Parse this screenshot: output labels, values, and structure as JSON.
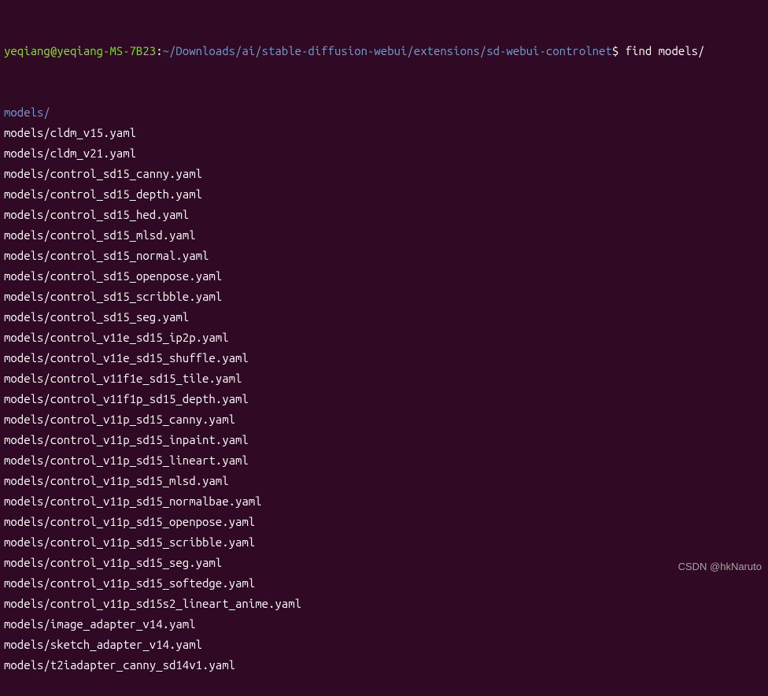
{
  "prompt": {
    "user_host": "yeqiang@yeqiang-MS-7B23",
    "separator1": ":",
    "path": "~/Downloads/ai/stable-diffusion-webui/extensions/sd-webui-controlnet",
    "separator2": "$ ",
    "command": "find models/"
  },
  "output": [
    {
      "text": "models/",
      "is_dir": true
    },
    {
      "text": "models/cldm_v15.yaml",
      "is_dir": false
    },
    {
      "text": "models/cldm_v21.yaml",
      "is_dir": false
    },
    {
      "text": "models/control_sd15_canny.yaml",
      "is_dir": false
    },
    {
      "text": "models/control_sd15_depth.yaml",
      "is_dir": false
    },
    {
      "text": "models/control_sd15_hed.yaml",
      "is_dir": false
    },
    {
      "text": "models/control_sd15_mlsd.yaml",
      "is_dir": false
    },
    {
      "text": "models/control_sd15_normal.yaml",
      "is_dir": false
    },
    {
      "text": "models/control_sd15_openpose.yaml",
      "is_dir": false
    },
    {
      "text": "models/control_sd15_scribble.yaml",
      "is_dir": false
    },
    {
      "text": "models/control_sd15_seg.yaml",
      "is_dir": false
    },
    {
      "text": "models/control_v11e_sd15_ip2p.yaml",
      "is_dir": false
    },
    {
      "text": "models/control_v11e_sd15_shuffle.yaml",
      "is_dir": false
    },
    {
      "text": "models/control_v11f1e_sd15_tile.yaml",
      "is_dir": false
    },
    {
      "text": "models/control_v11f1p_sd15_depth.yaml",
      "is_dir": false
    },
    {
      "text": "models/control_v11p_sd15_canny.yaml",
      "is_dir": false
    },
    {
      "text": "models/control_v11p_sd15_inpaint.yaml",
      "is_dir": false
    },
    {
      "text": "models/control_v11p_sd15_lineart.yaml",
      "is_dir": false
    },
    {
      "text": "models/control_v11p_sd15_mlsd.yaml",
      "is_dir": false
    },
    {
      "text": "models/control_v11p_sd15_normalbae.yaml",
      "is_dir": false
    },
    {
      "text": "models/control_v11p_sd15_openpose.yaml",
      "is_dir": false
    },
    {
      "text": "models/control_v11p_sd15_scribble.yaml",
      "is_dir": false
    },
    {
      "text": "models/control_v11p_sd15_seg.yaml",
      "is_dir": false
    },
    {
      "text": "models/control_v11p_sd15_softedge.yaml",
      "is_dir": false
    },
    {
      "text": "models/control_v11p_sd15s2_lineart_anime.yaml",
      "is_dir": false
    },
    {
      "text": "models/image_adapter_v14.yaml",
      "is_dir": false
    },
    {
      "text": "models/sketch_adapter_v14.yaml",
      "is_dir": false
    },
    {
      "text": "models/t2iadapter_canny_sd14v1.yaml",
      "is_dir": false
    }
  ],
  "watermark": "CSDN @hkNaruto"
}
